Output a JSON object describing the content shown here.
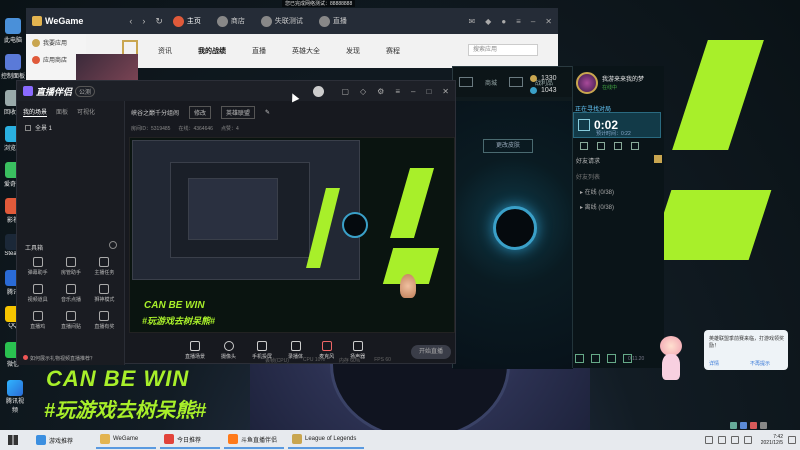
{
  "top_tooltip": "您已完成网络测试：88888888",
  "wegame": {
    "logo": "WeGame",
    "nav_back": "‹",
    "nav_forward": "›",
    "nav_refresh": "↻",
    "tabs": [
      "主页",
      "商店",
      "失联测试",
      "直播"
    ],
    "sub_nav": [
      "资讯",
      "我的战绩",
      "直播",
      "英雄大全",
      "发现",
      "赛程"
    ],
    "search_placeholder": "搜索应用",
    "side_items": [
      "我要应用",
      "应用商店"
    ]
  },
  "lol": {
    "button_left": "更改皮肤",
    "stats": {
      "rp": "1330",
      "be": "1043"
    },
    "top_labels": [
      "商城",
      "战利品"
    ],
    "profile_name": "我游来来我的梦",
    "profile_status": "在线中",
    "queue_label": "正在寻找对局",
    "timer": "0:02",
    "timer_sub": "预计时间：0:22",
    "friends_header": "好友请求",
    "friends_subheader": "好友列表",
    "friend_groups": [
      "▸ 在线 (0/38)",
      "▸ 离线 (0/38)"
    ],
    "version": "0.11.20"
  },
  "stream": {
    "logo": "直播伴侣",
    "logo_tag": "公测",
    "left_tabs": [
      "我的场景",
      "面板",
      "可视化"
    ],
    "scene_name": "全景 1",
    "tools_title": "工具箱",
    "tools": [
      "弹幕助手",
      "房管助手",
      "主播任务",
      "视频道具",
      "音乐点播",
      "狮神模式",
      "直播鸡",
      "直播间贴",
      "直播有奖"
    ],
    "help_text": "如何展示礼物视频直播推荐？",
    "room_title": "峡谷之巅千分组闹",
    "room_edit": "修改",
    "room_category": "英雄联盟",
    "room_row2": [
      "房间ID：5319485",
      "在线：4364646",
      "点赞：4"
    ],
    "preview_brand1": "CAN BE WIN",
    "preview_brand2": "#玩游戏去树呆熊#",
    "controls": [
      "直播场景",
      "摄像头",
      "手机投屏",
      "录播体",
      "麦克风",
      "扬声器"
    ],
    "start_button": "开始直播",
    "status": [
      "丢帧(CPU)",
      "CPU 10%",
      "内存 60%",
      "FPS 60"
    ]
  },
  "brand": {
    "line1": "CAN BE WIN",
    "line2": "#玩游戏去树呆熊#"
  },
  "desktop_icons": [
    "此电脑",
    "控制面板",
    "回收站",
    "浏览器",
    "爱奇艺",
    "影视",
    "Steam",
    "腾讯",
    "QQ",
    "微信",
    "WeGame"
  ],
  "tencent_icon": "腾讯视频",
  "toast": {
    "text": "英雄联盟季前赛来临，打游戏领奖励！",
    "link1": "详情",
    "link2": "不再提示"
  },
  "taskbar": {
    "items": [
      {
        "label": "游戏推荐",
        "color": "#3b8fe0"
      },
      {
        "label": "WeGame",
        "color": "#e3b450"
      },
      {
        "label": "今日推荐",
        "color": "#e2433a"
      },
      {
        "label": "斗鱼直播伴侣",
        "color": "#ff7a1a"
      },
      {
        "label": "League of Legends",
        "color": "#c9a650"
      }
    ],
    "time": "7:42",
    "date": "2021/12/5"
  }
}
